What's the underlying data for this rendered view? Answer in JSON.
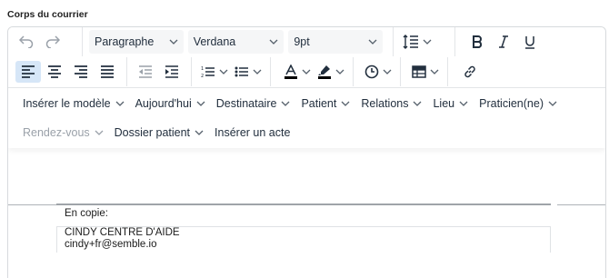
{
  "section": {
    "label": "Corps du courrier"
  },
  "toolbar": {
    "undo_icon": "undo-icon",
    "redo_icon": "redo-icon",
    "block_format": "Paragraphe",
    "font_family": "Verdana",
    "font_size": "9pt",
    "line_height_icon": "line-height-icon",
    "bold_icon": "bold-icon",
    "italic_icon": "italic-icon",
    "underline_icon": "underline-icon",
    "align_left_icon": "align-left-icon",
    "align_center_icon": "align-center-icon",
    "align_right_icon": "align-right-icon",
    "justify_icon": "align-justify-icon",
    "outdent_icon": "outdent-icon",
    "indent_icon": "indent-icon",
    "numbered_list_icon": "numbered-list-icon",
    "bullet_list_icon": "bullet-list-icon",
    "text_color_icon": "text-color-icon",
    "highlight_icon": "highlight-icon",
    "time_icon": "clock-icon",
    "table_icon": "table-icon",
    "link_icon": "link-icon",
    "accent_color": "#d6e6f7",
    "text_color_bar": "#000000",
    "highlight_bar": "#000000"
  },
  "menus": {
    "row1": [
      {
        "label": "Insérer le modèle",
        "dropdown": true
      },
      {
        "label": "Aujourd'hui",
        "dropdown": true
      },
      {
        "label": "Destinataire",
        "dropdown": true
      },
      {
        "label": "Patient",
        "dropdown": true
      },
      {
        "label": "Relations",
        "dropdown": true
      },
      {
        "label": "Lieu",
        "dropdown": true
      },
      {
        "label": "Praticien(ne)",
        "dropdown": true
      }
    ],
    "row2": [
      {
        "label": "Rendez-vous",
        "dropdown": true,
        "disabled": true
      },
      {
        "label": "Dossier patient",
        "dropdown": true
      },
      {
        "label": "Insérer un acte",
        "dropdown": false
      }
    ]
  },
  "content": {
    "copy_label": "En copie:",
    "copy_lines": [
      "CINDY CENTRE D'AIDE",
      "cindy+fr@semble.io"
    ]
  }
}
